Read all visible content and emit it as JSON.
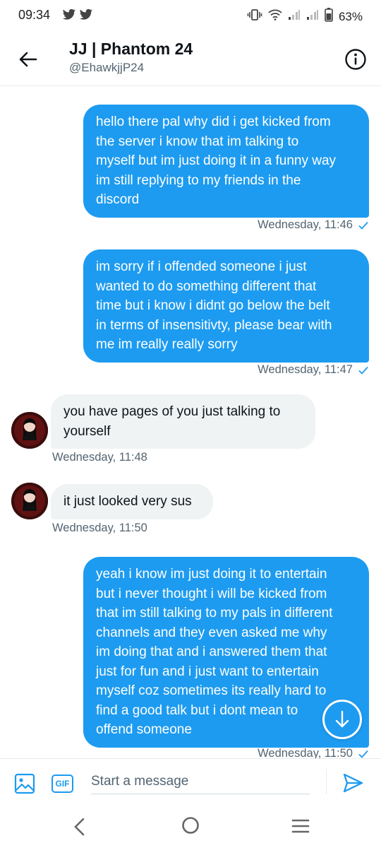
{
  "status_bar": {
    "time": "09:34",
    "battery": "63%",
    "left_icons": [
      "twitter-icon",
      "twitter-icon"
    ],
    "right_icons": [
      "vibrate-icon",
      "wifi-icon",
      "signal-icon",
      "signal-icon",
      "battery-icon"
    ]
  },
  "header": {
    "title": "JJ | Phantom 24",
    "handle": "@EhawkjjP24"
  },
  "messages": [
    {
      "direction": "sent",
      "lines": [
        "hello there pal why did i get kicked from",
        "the server i know that im talking to",
        "myself but im just doing it in a funny way",
        "im still replying to my friends in the",
        "discord"
      ],
      "timestamp": "Wednesday, 11:46",
      "seen": true
    },
    {
      "direction": "sent",
      "lines": [
        "im sorry if i offended someone i just",
        "wanted to do something different that",
        "time but i know i didnt go below the belt",
        "in terms of insensitivty, please bear with",
        "me im really really sorry"
      ],
      "timestamp": "Wednesday, 11:47",
      "seen": true
    },
    {
      "direction": "received",
      "lines": [
        "you have pages of you just talking to",
        "yourself"
      ],
      "timestamp": "Wednesday, 11:48"
    },
    {
      "direction": "received",
      "lines": [
        "it just looked very sus"
      ],
      "timestamp": "Wednesday, 11:50"
    },
    {
      "direction": "sent",
      "lines": [
        "yeah i know im just doing it to entertain",
        "but i never thought i will be kicked from",
        "that im still talking to my pals in different",
        "channels and they even asked me why",
        "im doing that and i answered them that",
        "just for fun and i just want to entertain",
        "myself coz sometimes its really hard to",
        "find a good talk but i dont mean to",
        "offend someone"
      ],
      "timestamp": "Wednesday, 11:50",
      "seen": true
    }
  ],
  "composer": {
    "placeholder": "Start a message",
    "gif_label": "GIF"
  },
  "colors": {
    "accent": "#1d9bf0",
    "received_bubble": "#eff3f4",
    "secondary_text": "#536471"
  }
}
